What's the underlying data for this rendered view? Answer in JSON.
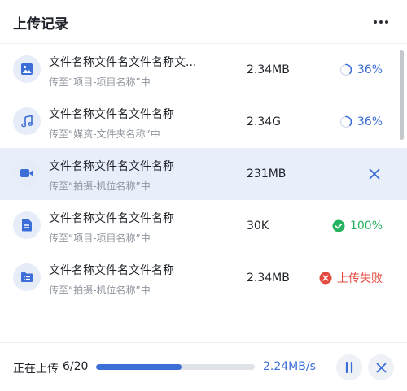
{
  "header": {
    "title": "上传记录",
    "more_icon": "more-horizontal-icon"
  },
  "uploads": [
    {
      "name": "文件名称文件名文件名称文...",
      "destination": "传至“项目-项目名称”中",
      "size": "2.34MB",
      "icon": "image-file-icon",
      "status": "uploading",
      "progress_text": "36%",
      "progress": 0.36,
      "active": false
    },
    {
      "name": "文件名称文件名文件名称",
      "destination": "传至“媒资-文件夹名称”中",
      "size": "2.34G",
      "icon": "audio-file-icon",
      "status": "uploading",
      "progress_text": "36%",
      "progress": 0.36,
      "active": false
    },
    {
      "name": "文件名称文件名文件名称",
      "destination": "传至“拍摄-机位名称”中",
      "size": "231MB",
      "icon": "video-file-icon",
      "status": "hover-cancel",
      "active": true
    },
    {
      "name": "文件名称文件名文件名称",
      "destination": "传至“项目-项目名称”中",
      "size": "30K",
      "icon": "document-file-icon",
      "status": "success",
      "status_text": "100%",
      "active": false
    },
    {
      "name": "文件名称文件名文件名称",
      "destination": "传至“拍摄-机位名称”中",
      "size": "2.34MB",
      "icon": "folder-list-icon",
      "status": "failed",
      "status_text": "上传失败",
      "active": false
    }
  ],
  "footer": {
    "label": "正在上传",
    "count": "6/20",
    "progress": 0.54,
    "speed": "2.24MB/s"
  },
  "colors": {
    "accent": "#3c6ed7",
    "success": "#26b35f",
    "error": "#e5483d",
    "active_row": "#e9eefb",
    "icon_bg": "#e6ecf8"
  }
}
